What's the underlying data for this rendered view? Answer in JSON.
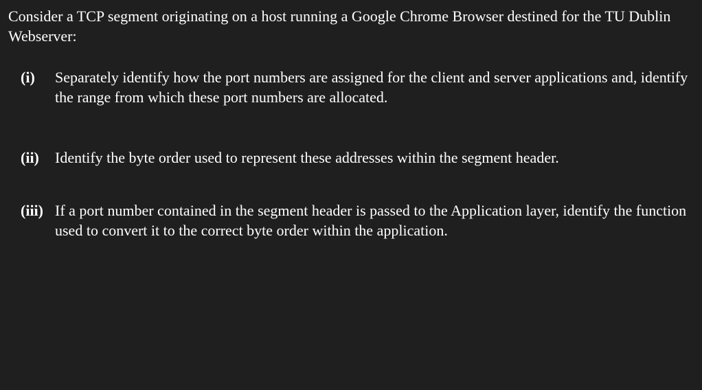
{
  "intro": "Consider a TCP segment originating on a host running a Google Chrome Browser destined for the TU Dublin Webserver:",
  "questions": [
    {
      "marker": "(i)",
      "text": "Separately identify how the port numbers are assigned for the client and server applications and, identify the range from which these port numbers are allocated."
    },
    {
      "marker": "(ii)",
      "text": "Identify the byte order used to represent these addresses within the segment header."
    },
    {
      "marker": "(iii)",
      "text": "If a port number contained in the segment header is passed to the Application layer, identify the function used to convert it to the correct byte order within the application."
    }
  ]
}
